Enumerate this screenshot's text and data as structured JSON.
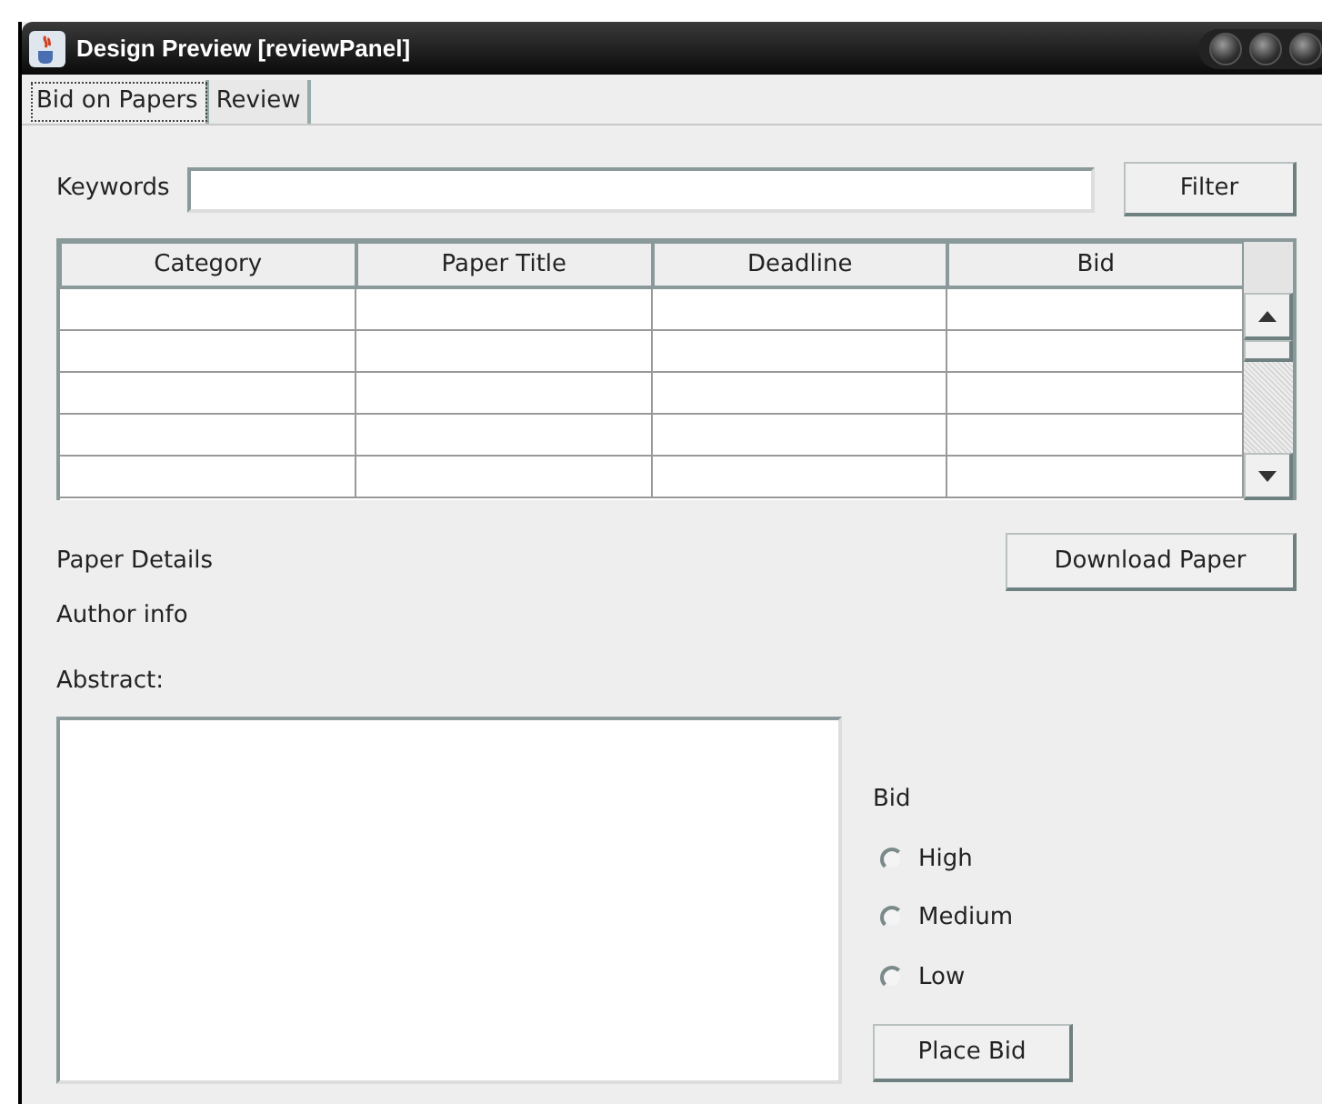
{
  "window": {
    "title": "Design Preview [reviewPanel]"
  },
  "tabs": [
    {
      "label": "Bid on Papers",
      "selected": true
    },
    {
      "label": "Review",
      "selected": false
    }
  ],
  "keywords": {
    "label": "Keywords",
    "button": "Filter"
  },
  "table": {
    "columns": [
      "Category",
      "Paper Title",
      "Deadline",
      "Bid"
    ]
  },
  "details": {
    "title": "Paper Details",
    "download_button": "Download Paper",
    "author": "Author info",
    "abstract_label": "Abstract:"
  },
  "bid": {
    "label": "Bid",
    "options": [
      {
        "label": "High",
        "selected": false
      },
      {
        "label": "Medium",
        "selected": false
      },
      {
        "label": "Low",
        "selected": false
      }
    ],
    "button": "Place Bid"
  }
}
